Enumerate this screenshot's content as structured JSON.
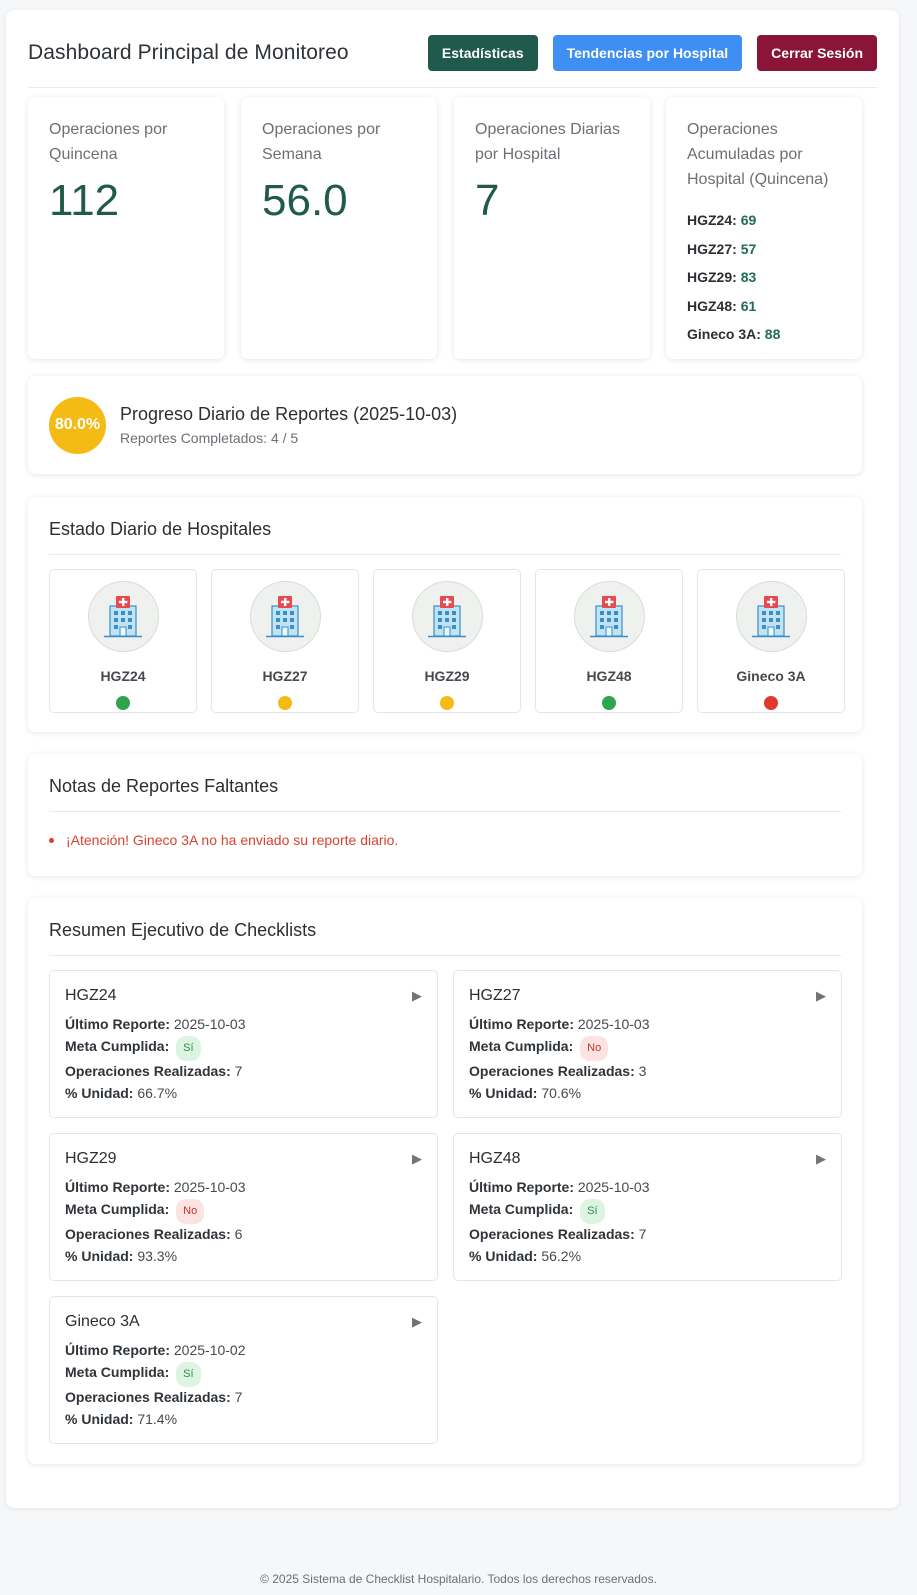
{
  "header": {
    "title": "Dashboard Principal de Monitoreo",
    "buttons": {
      "stats": "Estadísticas",
      "trends": "Tendencias por Hospital",
      "logout": "Cerrar Sesión"
    }
  },
  "metrics": [
    {
      "label": "Operaciones por Quincena",
      "value": "112"
    },
    {
      "label": "Operaciones por Semana",
      "value": "56.0"
    },
    {
      "label": "Operaciones Diarias por Hospital",
      "value": "7"
    }
  ],
  "accumulated": {
    "label": "Operaciones Acumuladas por Hospital (Quincena)",
    "rows": [
      {
        "name": "HGZ24:",
        "value": "69"
      },
      {
        "name": "HGZ27:",
        "value": "57"
      },
      {
        "name": "HGZ29:",
        "value": "83"
      },
      {
        "name": "HGZ48:",
        "value": "61"
      },
      {
        "name": "Gineco 3A:",
        "value": "88"
      }
    ]
  },
  "progress": {
    "percent_label": "80.0%",
    "percent": 80.0,
    "title": "Progreso Diario de Reportes (2025-10-03)",
    "subtitle": "Reportes Completados: 4 / 5"
  },
  "hospital_status": {
    "title": "Estado Diario de Hospitales",
    "items": [
      {
        "name": "HGZ24",
        "status": "green",
        "color": "#2ea44f"
      },
      {
        "name": "HGZ27",
        "status": "yellow",
        "color": "#f5bb14"
      },
      {
        "name": "HGZ29",
        "status": "yellow",
        "color": "#f5bb14"
      },
      {
        "name": "HGZ48",
        "status": "green",
        "color": "#2ea44f"
      },
      {
        "name": "Gineco 3A",
        "status": "red",
        "color": "#e03a2f"
      }
    ]
  },
  "notes": {
    "title": "Notas de Reportes Faltantes",
    "items": [
      "¡Atención! Gineco 3A no ha enviado su reporte diario."
    ]
  },
  "checklists": {
    "title": "Resumen Ejecutivo de Checklists",
    "labels": {
      "last": "Último Reporte:",
      "goal": "Meta Cumplida:",
      "ops": "Operaciones Realizadas:",
      "unit": "% Unidad:"
    },
    "items": [
      {
        "name": "HGZ24",
        "last": "2025-10-03",
        "goal": "Sí",
        "goal_ok": true,
        "ops": "7",
        "unit": "66.7%"
      },
      {
        "name": "HGZ27",
        "last": "2025-10-03",
        "goal": "No",
        "goal_ok": false,
        "ops": "3",
        "unit": "70.6%"
      },
      {
        "name": "HGZ29",
        "last": "2025-10-03",
        "goal": "No",
        "goal_ok": false,
        "ops": "6",
        "unit": "93.3%"
      },
      {
        "name": "HGZ48",
        "last": "2025-10-03",
        "goal": "Sí",
        "goal_ok": true,
        "ops": "7",
        "unit": "56.2%"
      },
      {
        "name": "Gineco 3A",
        "last": "2025-10-02",
        "goal": "Sí",
        "goal_ok": true,
        "ops": "7",
        "unit": "71.4%"
      }
    ]
  },
  "footer": {
    "text": "© 2025 Sistema de Checklist Hospitalario. Todos los derechos reservados."
  },
  "icons": {
    "hospital": "hospital-building-icon",
    "expand": "triangle-right-icon"
  }
}
